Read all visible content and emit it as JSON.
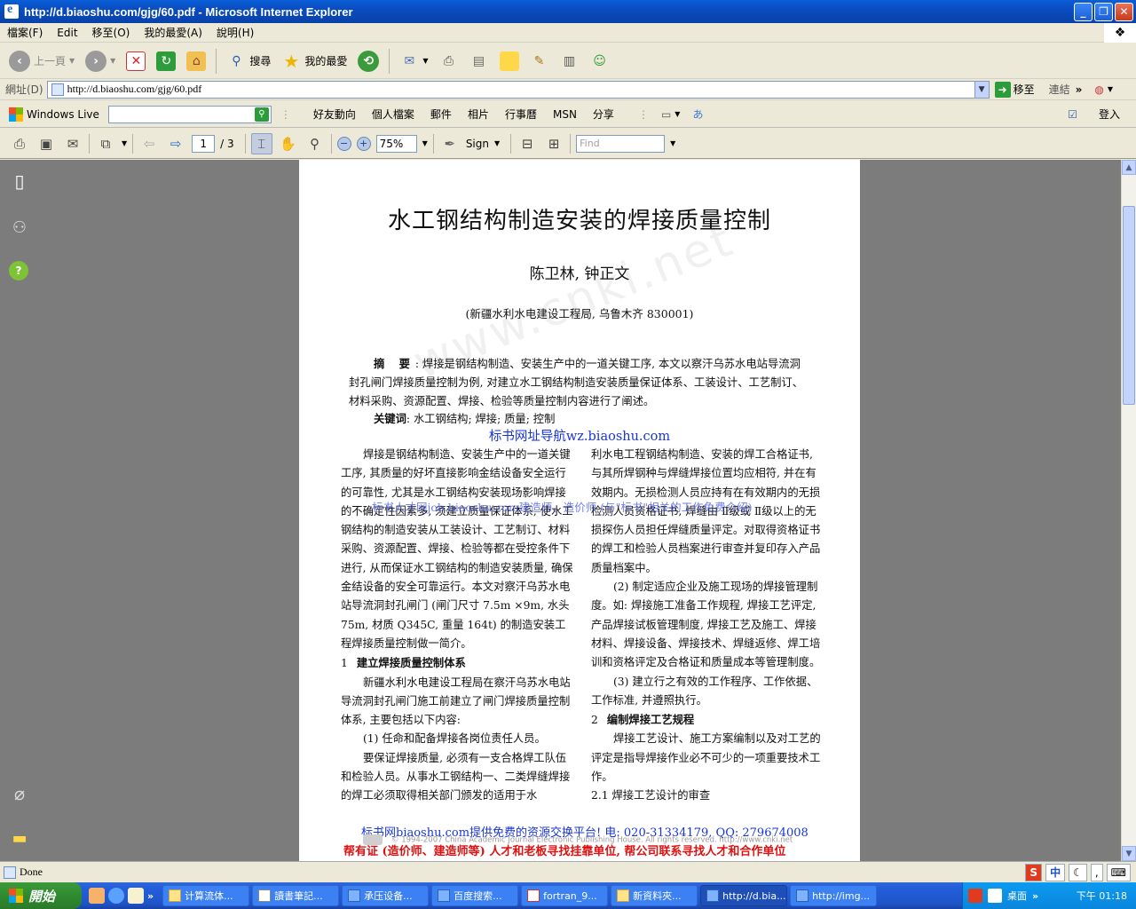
{
  "window": {
    "title": "http://d.biaoshu.com/gjg/60.pdf - Microsoft Internet Explorer",
    "min_symbol": "_",
    "max_symbol": "❐",
    "close_symbol": "✕"
  },
  "menu": [
    "檔案(F)",
    "Edit",
    "移至(O)",
    "我的最愛(A)",
    "說明(H)"
  ],
  "toolbar": {
    "back": "上一頁",
    "search": "搜尋",
    "favorites": "我的最愛"
  },
  "address": {
    "label": "網址(D)",
    "url": "http://d.biaoshu.com/gjg/60.pdf",
    "go": "移至",
    "links": "連結"
  },
  "live": {
    "brand": "Windows Live",
    "search_placeholder": "",
    "links": [
      "好友動向",
      "個人檔案",
      "郵件",
      "相片",
      "行事曆",
      "MSN",
      "分享"
    ],
    "signin": "登入"
  },
  "pdf_toolbar": {
    "page": "1",
    "page_total": "/ 3",
    "zoom": "75%",
    "sign": "Sign",
    "find_placeholder": "Find"
  },
  "doc": {
    "title": "水工钢结构制造安装的焊接质量控制",
    "authors": "陈卫林, 钟正文",
    "affiliation": "(新疆水利水电建设工程局, 乌鲁木齐   830001)",
    "watermark": "www.cnki.net",
    "abstract_label": "摘 要",
    "abstract_text": ": 焊接是钢结构制造、安装生产中的一道关键工序, 本文以察汗乌苏水电站导流洞封孔闸门焊接质量控制为例, 对建立水工钢结构制造安装质量保证体系、工装设计、工艺制订、材料采购、资源配置、焊接、检验等质量控制内容进行了阐述。",
    "keywords_label": "关键词",
    "keywords_text": ": 水工钢结构; 焊接; 质量; 控制",
    "ad_nav": "标书网址导航wz.biaoshu.com",
    "overlay_ad": "标书人才网job.biaoshu.com建造师、造价师 (与\"标书\"相关的工作免费介绍)",
    "left_col": [
      "焊接是钢结构制造、安装生产中的一道关键工序, 其质量的好坏直接影响金结设备安全运行的可靠性, 尤其是水工钢结构安装现场影响焊接的不确定性因素多, 须建立质量保证体系, 使水工钢结构的制造安装从工装设计、工艺制订、材料采购、资源配置、焊接、检验等都在受控条件下进行, 从而保证水工钢结构的制造安装质量, 确保金结设备的安全可靠运行。本文对察汗乌苏水电站导流洞封孔闸门 (闸门尺寸 7.5m ×9m, 水头 75m, 材质 Q345C, 重量 164t) 的制造安装工程焊接质量控制做一简介。"
    ],
    "left_h1_num": "1",
    "left_h1": "建立焊接质量控制体系",
    "left_col2": [
      "新疆水利水电建设工程局在察汗乌苏水电站导流洞封孔闸门施工前建立了闸门焊接质量控制体系, 主要包括以下内容:",
      "(1) 任命和配备焊接各岗位责任人员。",
      "要保证焊接质量, 必须有一支合格焊工队伍和检验人员。从事水工钢结构一、二类焊缝焊接的焊工必须取得相关部门颁发的适用于水"
    ],
    "right_col": [
      "利水电工程钢结构制造、安装的焊工合格证书, 与其所焊钢种与焊缝焊接位置均应相符, 并在有效期内。无损检测人员应持有在有效期内的无损检测人员资格证书, 焊缝由 Ⅱ级或 Ⅱ级以上的无损探伤人员担任焊缝质量评定。对取得资格证书的焊工和检验人员档案进行审查并复印存入产品质量档案中。",
      "(2) 制定适应企业及施工现场的焊接管理制度。如: 焊接施工准备工作规程, 焊接工艺评定, 产品焊接试板管理制度, 焊接工艺及施工、焊接材料、焊接设备、焊接技术、焊缝返修、焊工培训和资格评定及合格证和质量成本等管理制度。",
      "(3) 建立行之有效的工作程序、工作依据、工作标准, 并遵照执行。"
    ],
    "right_h2_num": "2",
    "right_h2": "编制焊接工艺规程",
    "right_col2": [
      "焊接工艺设计、施工方案编制以及对工艺的评定是指导焊接作业必不可少的一项重要技术工作。"
    ],
    "right_sub": "2.1   焊接工艺设计的审查",
    "footer_blue": "标书网biaoshu.com提供免费的资源交换平台! 电: 020-31334179, QQ: 279674008",
    "footer_gray": "© 1994-2007 China Academic Journal Electronic Publishing House. All rights reserved.    http://www.cnki.net",
    "footer_red": "帮有证 (造价师、建造师等) 人才和老板寻找挂靠单位, 帮公司联系寻找人才和合作单位"
  },
  "status": {
    "text": "Done",
    "ime_letter": "S",
    "ime_lang": "中"
  },
  "taskbar": {
    "start": "開始",
    "tasks": [
      "计算流体...",
      "讀書筆記...",
      "承压设备...",
      "百度搜索...",
      "fortran_9...",
      "新資料夾...",
      "http://d.bia...",
      "http://img..."
    ],
    "active_index": 6,
    "tray_label": "桌面",
    "clock": "下午 01:18"
  }
}
